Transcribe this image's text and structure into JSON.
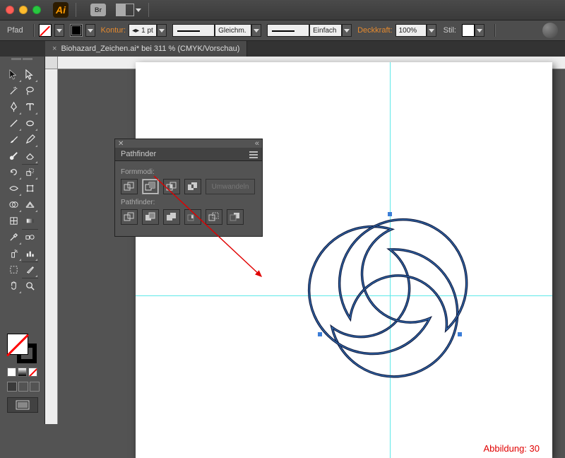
{
  "titlebar": {
    "app_short": "Ai",
    "bridge": "Br"
  },
  "controlbar": {
    "path_label": "Pfad",
    "kontur_label": "Kontur:",
    "stroke_weight": "1 pt",
    "profile_label": "Gleichm.",
    "brush_label": "Einfach",
    "opacity_label": "Deckkraft:",
    "opacity_value": "100%",
    "style_label": "Stil:"
  },
  "doc_tab": {
    "title": "Biohazard_Zeichen.ai* bei 311 % (CMYK/Vorschau)"
  },
  "pathfinder": {
    "title": "Pathfinder",
    "shapemodes_label": "Formmodi:",
    "expand_label": "Umwandeln",
    "pathfinder_label": "Pathfinder:"
  },
  "caption": "Abbildung: 30"
}
